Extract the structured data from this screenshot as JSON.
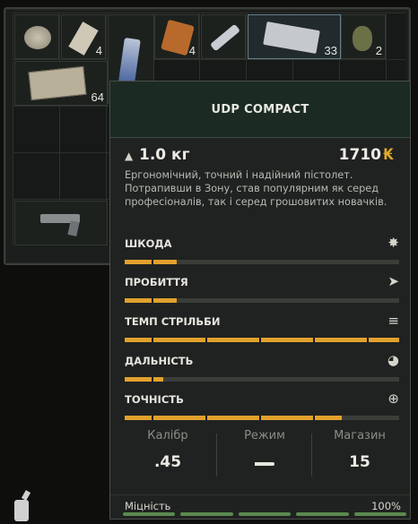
{
  "inventory": {
    "items": [
      {
        "name": "canned-food-item",
        "qty": ""
      },
      {
        "name": "bandage-item",
        "qty": "4"
      },
      {
        "name": "energy-drink-item",
        "qty": ""
      },
      {
        "name": "bread-item",
        "qty": "4"
      },
      {
        "name": "syringe-item",
        "qty": ""
      },
      {
        "name": "ammo-box-item",
        "qty": "33"
      },
      {
        "name": "grenade-item",
        "qty": "2"
      },
      {
        "name": "ammo-crate-item",
        "qty": "64"
      },
      {
        "name": "pistol-item",
        "qty": ""
      }
    ]
  },
  "tooltip": {
    "title": "UDP COMPACT",
    "weight": "1.0 кг",
    "price": "1710",
    "currency_symbol": "₭",
    "description": "Ергономічний, точний і надійний пістолет. Потрапивши в Зону, став популярним як серед професіоналів, так і серед грошовитих новачків.",
    "stats": [
      {
        "label": "ШКОДА",
        "icon": "burst-icon",
        "fill": 0.19
      },
      {
        "label": "ПРОБИТТЯ",
        "icon": "penetration-icon",
        "fill": 0.19
      },
      {
        "label": "ТЕМП СТРІЛЬБИ",
        "icon": "fire-rate-icon",
        "fill": 1.0
      },
      {
        "label": "ДАЛЬНІСТЬ",
        "icon": "range-icon",
        "fill": 0.14
      },
      {
        "label": "ТОЧНІСТЬ",
        "icon": "crosshair-icon",
        "fill": 0.79
      }
    ],
    "specs": {
      "caliber_label": "Калібр",
      "caliber_value": ".45",
      "mode_label": "Режим",
      "magazine_label": "Магазин",
      "magazine_value": "15"
    },
    "durability": {
      "label": "Міцність",
      "value": "100%"
    }
  },
  "colors": {
    "accent": "#e2a12d",
    "header": "#1b2a22",
    "durability": "#5a8a4e"
  }
}
